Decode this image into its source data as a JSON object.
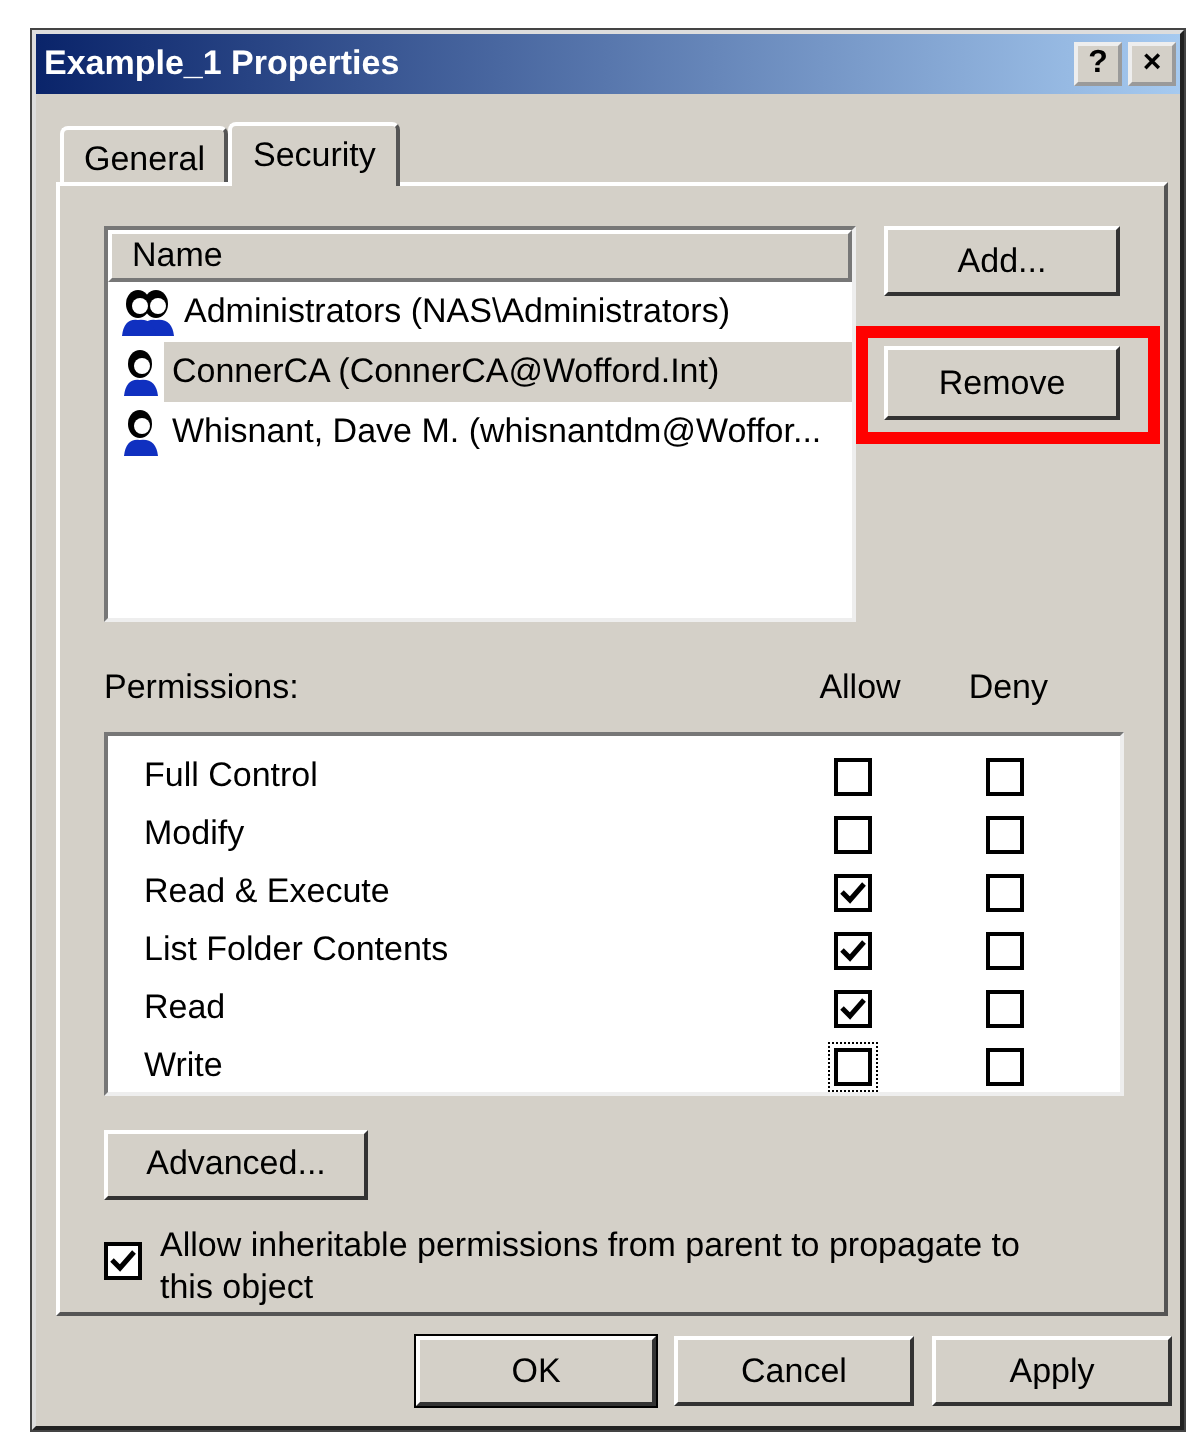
{
  "window": {
    "title": "Example_1 Properties",
    "title_buttons": [
      "?",
      "×"
    ]
  },
  "tabs": [
    {
      "label": "General",
      "selected": false
    },
    {
      "label": "Security",
      "selected": true
    }
  ],
  "users": {
    "column": "Name",
    "rows": [
      {
        "kind": "group",
        "name": "Administrators (NAS\\Administrators)",
        "selected": false
      },
      {
        "kind": "user",
        "name": "ConnerCA (ConnerCA@Wofford.Int)",
        "selected": true
      },
      {
        "kind": "user",
        "name": "Whisnant, Dave M. (whisnantdm@Woffor...",
        "selected": false
      }
    ]
  },
  "side_buttons": [
    {
      "label": "Add...",
      "highlighted": false
    },
    {
      "label": "Remove",
      "highlighted": true
    }
  ],
  "permissions": {
    "label": "Permissions:",
    "allow_heading": "Allow",
    "deny_heading": "Deny",
    "rows": [
      {
        "name": "Full Control",
        "allow": false,
        "deny": false,
        "allow_focused": false
      },
      {
        "name": "Modify",
        "allow": false,
        "deny": false,
        "allow_focused": false
      },
      {
        "name": "Read & Execute",
        "allow": true,
        "deny": false,
        "allow_focused": false
      },
      {
        "name": "List Folder Contents",
        "allow": true,
        "deny": false,
        "allow_focused": false
      },
      {
        "name": "Read",
        "allow": true,
        "deny": false,
        "allow_focused": false
      },
      {
        "name": "Write",
        "allow": false,
        "deny": false,
        "allow_focused": true
      }
    ]
  },
  "advanced_button": "Advanced...",
  "inherit": {
    "label": "Allow inheritable permissions from parent to propagate to this object",
    "checked": true
  },
  "footer_buttons": [
    {
      "label": "OK",
      "default": true
    },
    {
      "label": "Cancel",
      "default": false
    },
    {
      "label": "Apply",
      "default": false
    }
  ]
}
